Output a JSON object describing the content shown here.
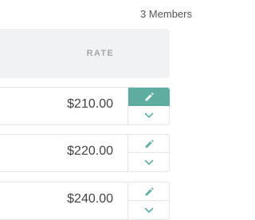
{
  "header": {
    "member_count": "3 Members",
    "rate_column": "RATE"
  },
  "rows": [
    {
      "rate": "$210.00",
      "edit_icon": "pencil-icon",
      "expand_icon": "chevron-down-icon",
      "edit_active": true
    },
    {
      "rate": "$220.00",
      "edit_icon": "pencil-icon",
      "expand_icon": "chevron-down-icon",
      "edit_active": false
    },
    {
      "rate": "$240.00",
      "edit_icon": "pencil-icon",
      "expand_icon": "chevron-down-icon",
      "edit_active": false
    }
  ],
  "colors": {
    "accent": "#5fada0",
    "header_bg": "#f1f2f3",
    "border": "#e3e5e7",
    "header_text": "#a3a8ad"
  }
}
